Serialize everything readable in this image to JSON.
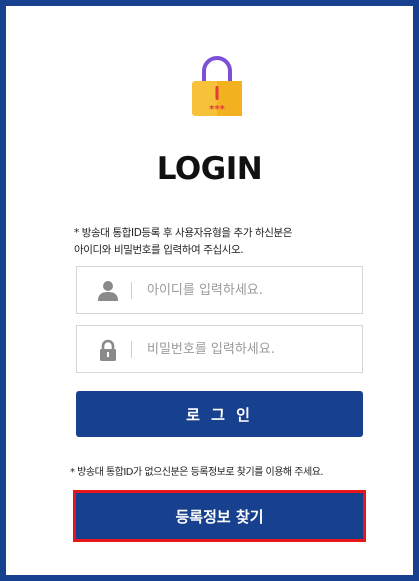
{
  "login": {
    "title": "LOGIN",
    "notice_line1": "* 방송대 통합ID등록 후 사용자유형을 추가 하신분은",
    "notice_line2": "아이디와 비밀번호를 입력하여 주십시오.",
    "id_field": {
      "placeholder": "아이디를 입력하세요.",
      "value": "",
      "icon": "user-icon"
    },
    "pw_field": {
      "placeholder": "비밀번호를 입력하세요.",
      "value": "",
      "icon": "padlock-icon"
    },
    "login_button": "로 그 인",
    "register_notice": "* 방송대 통합ID가 없으신분은 등록정보로 찾기를 이용해 주세요.",
    "find_button": "등록정보 찾기"
  },
  "colors": {
    "primary": "#17408f",
    "frame": "#17408f",
    "highlight": "#e8151a",
    "lock_body": "#f7c23a",
    "lock_shackle": "#7b4fd6",
    "lock_dots": "#e23b3b"
  }
}
